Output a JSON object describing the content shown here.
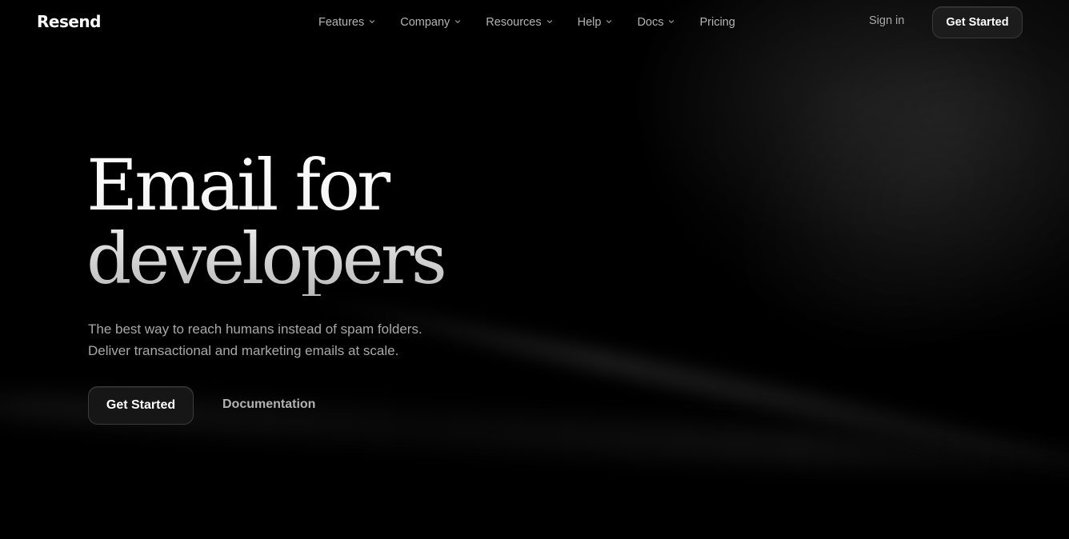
{
  "header": {
    "logo": "Resend",
    "nav": [
      {
        "label": "Features",
        "has_dropdown": true
      },
      {
        "label": "Company",
        "has_dropdown": true
      },
      {
        "label": "Resources",
        "has_dropdown": true
      },
      {
        "label": "Help",
        "has_dropdown": true
      },
      {
        "label": "Docs",
        "has_dropdown": true
      },
      {
        "label": "Pricing",
        "has_dropdown": false
      }
    ],
    "sign_in": "Sign in",
    "cta": "Get Started",
    "chevron_icon": "chevron-down-icon"
  },
  "hero": {
    "title_line1": "Email for",
    "title_line2": "developers",
    "subtitle_line1": "The best way to reach humans instead of spam folders.",
    "subtitle_line2": "Deliver transactional and marketing emails at scale.",
    "primary_cta": "Get Started",
    "secondary_cta": "Documentation"
  },
  "colors": {
    "background": "#000000",
    "text_primary": "#ffffff",
    "text_muted": "#a8a8a8",
    "button_bg": "#1c1c1c",
    "button_border": "#3a3a3a"
  }
}
